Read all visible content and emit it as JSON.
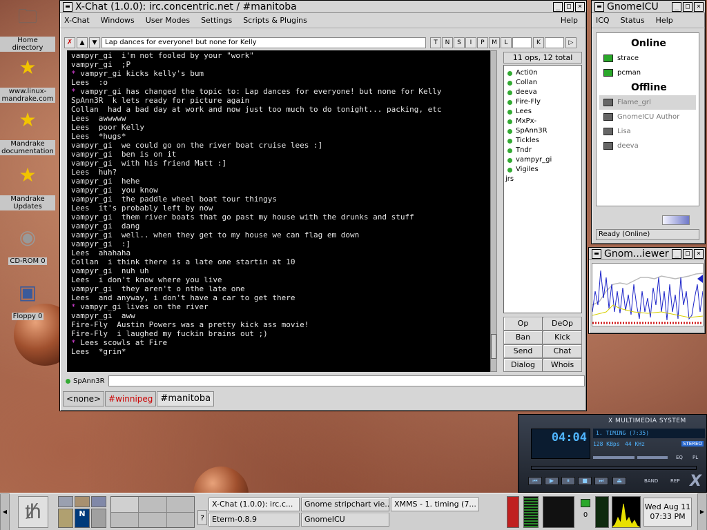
{
  "desktop_icons": [
    {
      "label": "Home directory",
      "icon": "folder-icon"
    },
    {
      "label": "www.linux-mandrake.com",
      "icon": "star-icon"
    },
    {
      "label": "Mandrake documentation",
      "icon": "star-icon"
    },
    {
      "label": "Mandrake Updates",
      "icon": "star-icon"
    },
    {
      "label": "CD-ROM 0",
      "icon": "cdrom-icon"
    },
    {
      "label": "Floppy 0",
      "icon": "floppy-icon"
    }
  ],
  "xchat": {
    "title": "X-Chat (1.0.0): irc.concentric.net / #manitoba",
    "menu": [
      "X-Chat",
      "Windows",
      "User Modes",
      "Settings",
      "Scripts & Plugins"
    ],
    "help": "Help",
    "topic": "Lap dances for everyone! but none for Kelly",
    "modes": [
      "T",
      "N",
      "S",
      "I",
      "P",
      "M",
      "L",
      "K"
    ],
    "ops_count": "11 ops, 12 total",
    "nicks": [
      "Acti0n",
      "Collan",
      "deeva",
      "Fire-Fly",
      "Lees",
      "MxPx-",
      "SpAnn3R",
      "Tickles",
      "Tndr",
      "vampyr_gi",
      "Vigiles",
      "jrs"
    ],
    "op_buttons": [
      "Op",
      "DeOp",
      "Ban",
      "Kick",
      "Send",
      "Chat",
      "Dialog",
      "Whois"
    ],
    "my_nick": "SpAnn3R",
    "input_value": "",
    "tabs": [
      "<none>",
      "#winnipeg",
      "#manitoba"
    ],
    "messages": [
      {
        "type": "msg",
        "nick": "vampyr_gi",
        "text": "i'm not fooled by your \"work\""
      },
      {
        "type": "msg",
        "nick": "vampyr_gi",
        "text": ";P"
      },
      {
        "type": "action",
        "nick": "",
        "text": "vampyr_gi kicks kelly's bum"
      },
      {
        "type": "msg",
        "nick": "Lees",
        "text": ":o"
      },
      {
        "type": "action",
        "nick": "",
        "text": "vampyr_gi has changed the topic to: Lap dances for everyone! but none for Kelly"
      },
      {
        "type": "msg",
        "nick": "SpAnn3R",
        "text": "k lets ready for picture again"
      },
      {
        "type": "msg",
        "nick": "Collan",
        "text": "had a bad day at work and now just too much to do tonight... packing, etc"
      },
      {
        "type": "msg",
        "nick": "Lees",
        "text": "awwwww"
      },
      {
        "type": "msg",
        "nick": "Lees",
        "text": "poor Kelly"
      },
      {
        "type": "msg",
        "nick": "Lees",
        "text": "*hugs*"
      },
      {
        "type": "msg",
        "nick": "vampyr_gi",
        "text": "we could go on the river boat cruise lees :]"
      },
      {
        "type": "msg",
        "nick": "vampyr_gi",
        "text": "ben is on it"
      },
      {
        "type": "msg",
        "nick": "vampyr_gi",
        "text": "with his friend Matt :]"
      },
      {
        "type": "msg",
        "nick": "Lees",
        "text": "huh?"
      },
      {
        "type": "msg",
        "nick": "vampyr_gi",
        "text": "hehe"
      },
      {
        "type": "msg",
        "nick": "vampyr_gi",
        "text": "you know"
      },
      {
        "type": "msg",
        "nick": "vampyr_gi",
        "text": "the paddle wheel boat tour thingys"
      },
      {
        "type": "msg",
        "nick": "Lees",
        "text": "it's probably left by now"
      },
      {
        "type": "msg",
        "nick": "vampyr_gi",
        "text": "them river boats that go past my house with the drunks and stuff"
      },
      {
        "type": "msg",
        "nick": "vampyr_gi",
        "text": "dang"
      },
      {
        "type": "msg",
        "nick": "vampyr_gi",
        "text": "well.. when they get to my house we can flag em down"
      },
      {
        "type": "msg",
        "nick": "vampyr_gi",
        "text": ":]"
      },
      {
        "type": "msg",
        "nick": "Lees",
        "text": "ahahaha"
      },
      {
        "type": "msg",
        "nick": "Collan",
        "text": "i think there is a late one startin at 10"
      },
      {
        "type": "msg",
        "nick": "vampyr_gi",
        "text": "nuh uh"
      },
      {
        "type": "msg",
        "nick": "Lees",
        "text": "i don't know where you live"
      },
      {
        "type": "msg",
        "nick": "vampyr_gi",
        "text": "they aren't o nthe late one"
      },
      {
        "type": "msg",
        "nick": "Lees",
        "text": "and anyway, i don't have a car to get there"
      },
      {
        "type": "action",
        "nick": "",
        "text": "vampyr_gi lives on the river"
      },
      {
        "type": "msg",
        "nick": "vampyr_gi",
        "text": "aww"
      },
      {
        "type": "msg",
        "nick": "Fire-Fly",
        "text": "Austin Powers was a pretty kick ass movie!"
      },
      {
        "type": "msg",
        "nick": "Fire-Fly",
        "text": "i laughed my fuckin brains out ;)"
      },
      {
        "type": "action",
        "nick": "",
        "text": "Lees scowls at Fire"
      },
      {
        "type": "msg",
        "nick": "Lees",
        "text": "*grin*"
      }
    ]
  },
  "gnomeicu": {
    "title": "GnomeICU",
    "menu": [
      "ICQ",
      "Status",
      "Help"
    ],
    "online_header": "Online",
    "offline_header": "Offline",
    "online": [
      "strace",
      "pcman"
    ],
    "offline": [
      "Flame_grl",
      "GnomeICU Author",
      "Lisa",
      "deeva"
    ],
    "status": "Ready (Online)"
  },
  "stripchart": {
    "title": "Gnom...iewer"
  },
  "xmms": {
    "title": "X MULTIMEDIA SYSTEM",
    "time": "04:04",
    "song": "1. TIMING (7:35)",
    "bitrate": "128 KBps",
    "freq": "44 KHz",
    "stereo": "STEREO",
    "eq": "EQ",
    "pl": "PL",
    "band": "BAND",
    "rep": "REP"
  },
  "panel": {
    "tasks_top": [
      "X-Chat (1.0.0): irc.c...",
      "Gnome stripchart vie...",
      "XMMS - 1. timing (7..."
    ],
    "tasks_bottom": [
      "Eterm-0.8.9",
      "GnomeICU"
    ],
    "clock_date": "Wed Aug 11",
    "clock_time": "07:33 PM",
    "mail_count": "0",
    "help_label": "?"
  }
}
